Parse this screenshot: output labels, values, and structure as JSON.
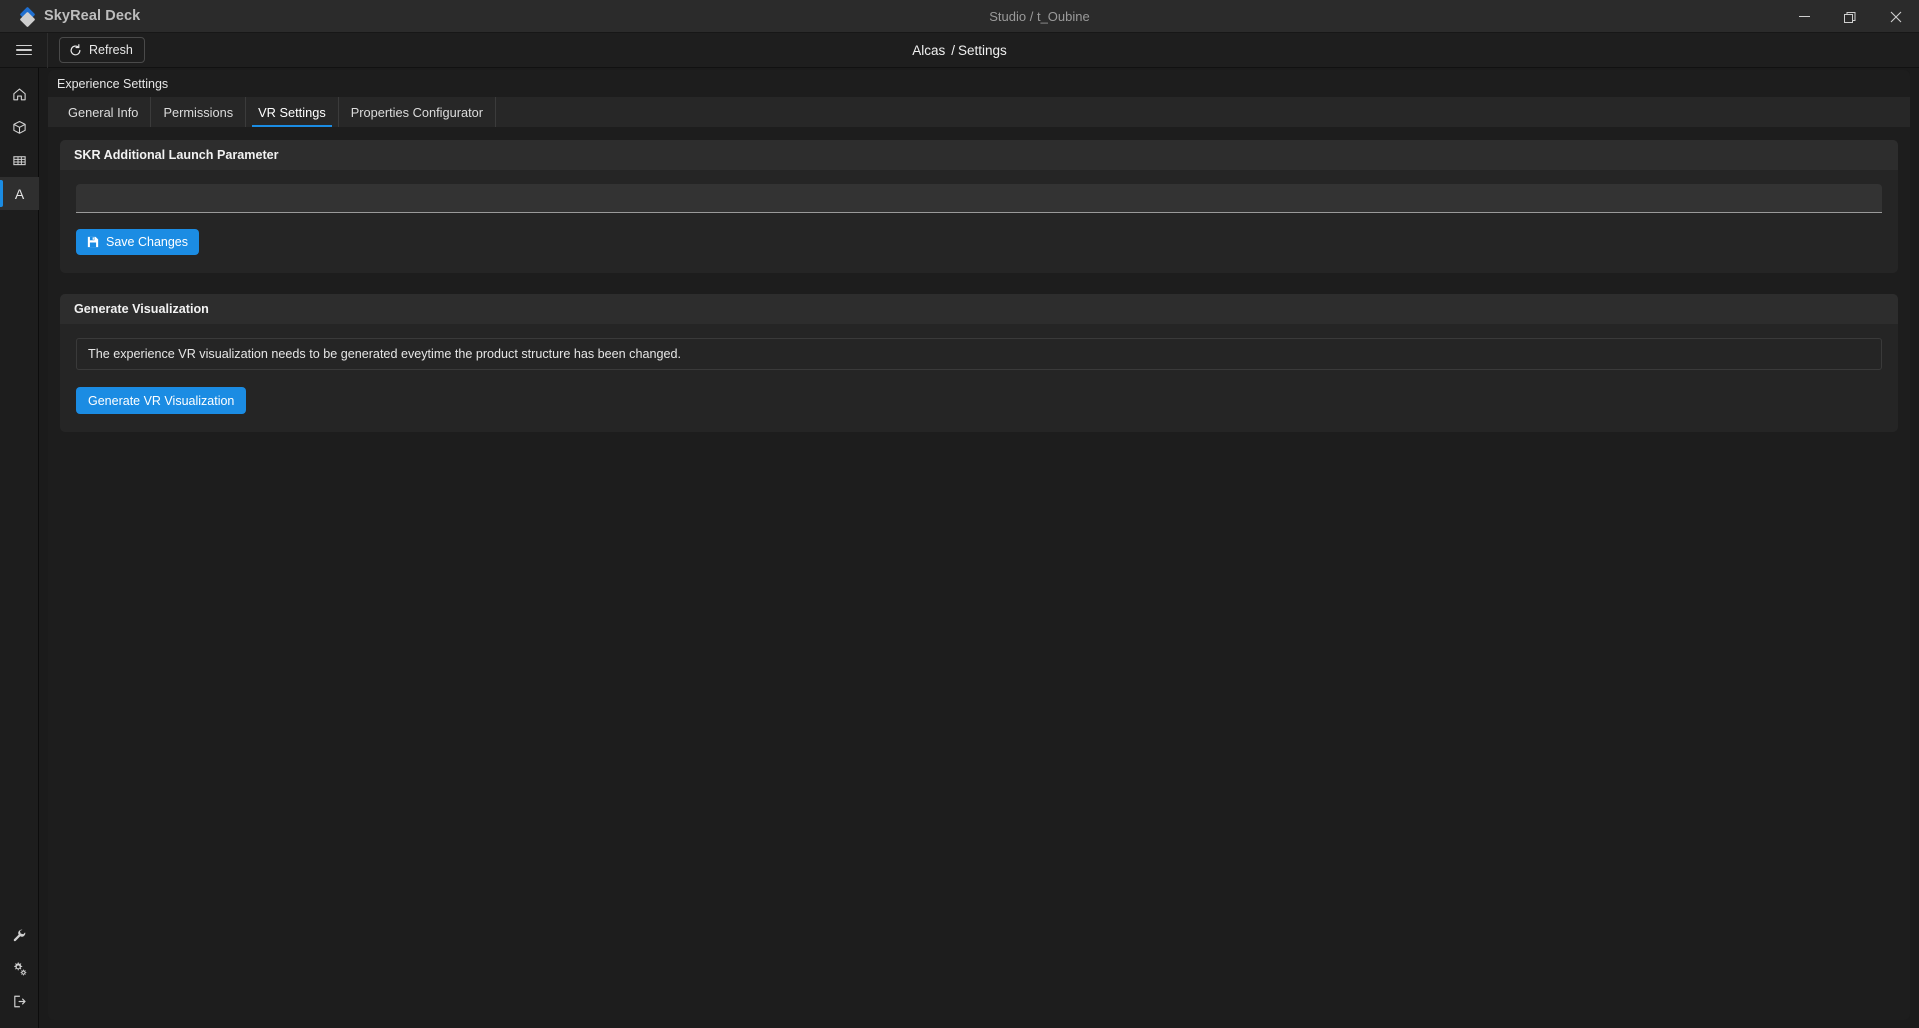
{
  "titlebar": {
    "app_name": "SkyReal Deck",
    "center_title": "Studio / t_Oubine",
    "minimize_label": "Minimize",
    "restore_label": "Restore",
    "close_label": "Close"
  },
  "actionbar": {
    "menu_label": "Menu",
    "refresh_label": "Refresh",
    "breadcrumb": {
      "root": "Alcas",
      "separator": "/",
      "current": "Settings"
    }
  },
  "rail": {
    "top_items": [
      {
        "name": "home",
        "label": "Home",
        "active": false
      },
      {
        "name": "product",
        "label": "Product",
        "active": false
      },
      {
        "name": "list",
        "label": "List",
        "active": false
      },
      {
        "name": "experience",
        "label": "A",
        "active": true
      }
    ],
    "bottom_items": [
      {
        "name": "tools",
        "label": "Tools"
      },
      {
        "name": "admin",
        "label": "Administration"
      },
      {
        "name": "logout",
        "label": "Logout"
      }
    ]
  },
  "panel": {
    "title": "Experience Settings",
    "tabs": [
      {
        "label": "General Info",
        "active": false
      },
      {
        "label": "Permissions",
        "active": false
      },
      {
        "label": "VR Settings",
        "active": true
      },
      {
        "label": "Properties Configurator",
        "active": false
      }
    ]
  },
  "launch_parameter_card": {
    "title": "SKR Additional Launch Parameter",
    "input_value": "",
    "input_placeholder": "",
    "save_label": "Save Changes"
  },
  "generate_card": {
    "title": "Generate Visualization",
    "notice": "The experience VR visualization needs to be generated eveytime the product structure has been changed.",
    "button_label": "Generate VR Visualization"
  },
  "colors": {
    "accent": "#1b8ce3",
    "logo_blue": "#1f6fd0",
    "titlebar_bg": "#2b2b2b",
    "panel_bg": "#1d1d1d",
    "card_bg": "#252525",
    "card_header_bg": "#2d2d2d",
    "window_bg": "#1b1b1b"
  }
}
